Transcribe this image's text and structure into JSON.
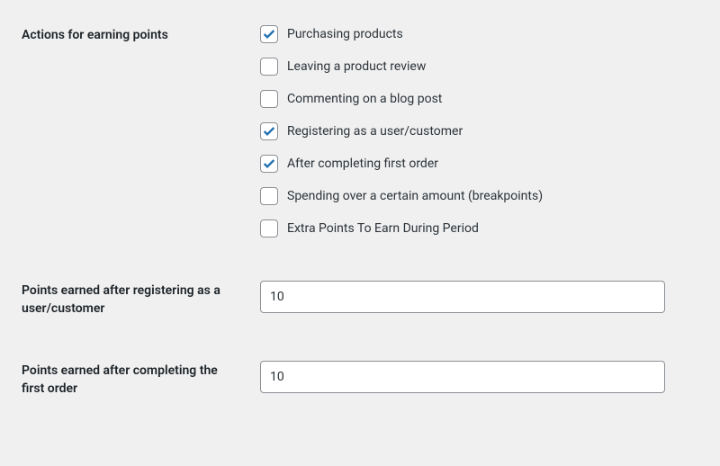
{
  "sections": {
    "actions": {
      "label": "Actions for earning points",
      "options": {
        "purchasing": {
          "label": "Purchasing products",
          "checked": true
        },
        "review": {
          "label": "Leaving a product review",
          "checked": false
        },
        "comment": {
          "label": "Commenting on a blog post",
          "checked": false
        },
        "register": {
          "label": "Registering as a user/customer",
          "checked": true
        },
        "first_order": {
          "label": "After completing first order",
          "checked": true
        },
        "breakpoints": {
          "label": "Spending over a certain amount (breakpoints)",
          "checked": false
        },
        "extra_period": {
          "label": "Extra Points To Earn During Period",
          "checked": false
        }
      }
    },
    "points_register": {
      "label": "Points earned after registering as a user/customer",
      "value": "10"
    },
    "points_first_order": {
      "label": "Points earned after completing the first order",
      "value": "10"
    }
  }
}
